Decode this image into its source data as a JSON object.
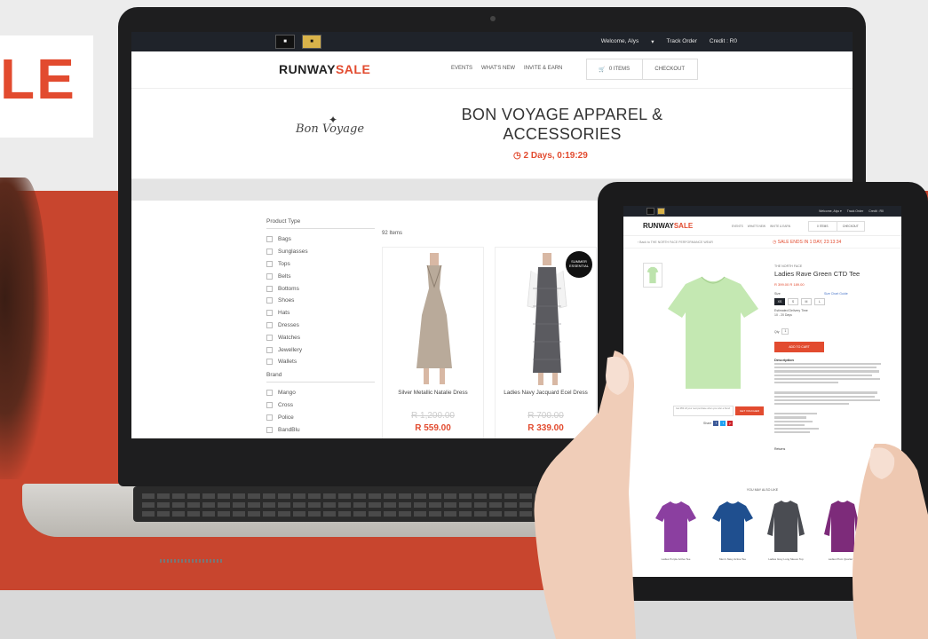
{
  "banner": {
    "sale_text": "LE",
    "colors": {
      "accent": "#e24b2f",
      "band": "#c8452e"
    }
  },
  "laptop_site": {
    "topbar": {
      "box1": "■",
      "box2": "■",
      "welcome": "Welcome, Alys",
      "track_order": "Track Order",
      "credit": "Credit : R0"
    },
    "logo": {
      "part1": "RUNWAY",
      "part2": "SALE"
    },
    "nav": [
      "EVENTS",
      "WHAT'S NEW",
      "INVITE & EARN"
    ],
    "cart": {
      "items": "0 ITEMS",
      "checkout": "CHECKOUT"
    },
    "hero": {
      "brand_logo": "Bon Voyage",
      "title_line1": "BON VOYAGE APPAREL &",
      "title_line2": "ACCESSORIES",
      "countdown": "◷ 2 Days, 0:19:29"
    },
    "filters": {
      "product_type_heading": "Product Type",
      "product_types": [
        "Bags",
        "Sunglasses",
        "Tops",
        "Belts",
        "Bottoms",
        "Shoes",
        "Hats",
        "Dresses",
        "Watches",
        "Jewellery",
        "Wallets"
      ],
      "brand_heading": "Brand",
      "brands": [
        "Mango",
        "Cross",
        "Police",
        "BandBlu"
      ]
    },
    "items_count": "92 Items",
    "products": [
      {
        "name": "Silver Metallic Natalie Dress",
        "old_price": "R 1,200.00",
        "new_price": "R 559.00"
      },
      {
        "name": "Ladies Navy Jacquard Ecel Dress",
        "old_price": "R 700.00",
        "new_price": "R 339.00",
        "badge": "SUMMER ESSENTIAL"
      }
    ]
  },
  "tablet_site": {
    "topbar": {
      "welcome": "Welcome, Alys ▾",
      "track_order": "Track Order",
      "credit": "Credit : R0"
    },
    "logo": {
      "part1": "RUNWAY",
      "part2": "SALE"
    },
    "nav": [
      "EVENTS",
      "WHAT'S NEW",
      "INVITE & EARN"
    ],
    "cart": {
      "items": "0 ITEMS",
      "checkout": "CHECKOUT"
    },
    "breadcrumb": "‹ Back to THE NORTH FACE PERFORMANCE WEAR",
    "sale_ends": "◷ SALE ENDS IN 1 DAY, 23:13:34",
    "product": {
      "brand": "THE NORTH FACE",
      "title": "Ladies Rave Green CTD Tee",
      "price": "R 399.00   R 189.00",
      "size_label": "Size",
      "size_guide": "Size Chart Guide",
      "sizes": [
        "XS",
        "S",
        "M",
        "L"
      ],
      "selected_size": "XS",
      "delivery": "Estimated Delivery Time",
      "delivery_value": "10 - 20 Days",
      "qty_label": "Qty",
      "qty_value": "1",
      "add_to_cart": "ADD TO CART",
      "description_heading": "Description",
      "returns": "Returns",
      "offer_text": "Get R50 off your next purchase when you refer a friend",
      "get_voucher": "GET VOUCHER",
      "share_label": "Share"
    },
    "also_like_heading": "YOU MAY ALSO LIKE",
    "also_like": [
      {
        "name": "Ladies Purple Active Tee",
        "color": "#8b3fa0"
      },
      {
        "name": "Men's Navy Active Tee",
        "color": "#1f4f8f"
      },
      {
        "name": "Ladies Grey Long Sleeve Top",
        "color": "#4a4c52"
      },
      {
        "name": "Ladies Plum Quarter Zip",
        "color": "#7d2b7a"
      }
    ]
  }
}
